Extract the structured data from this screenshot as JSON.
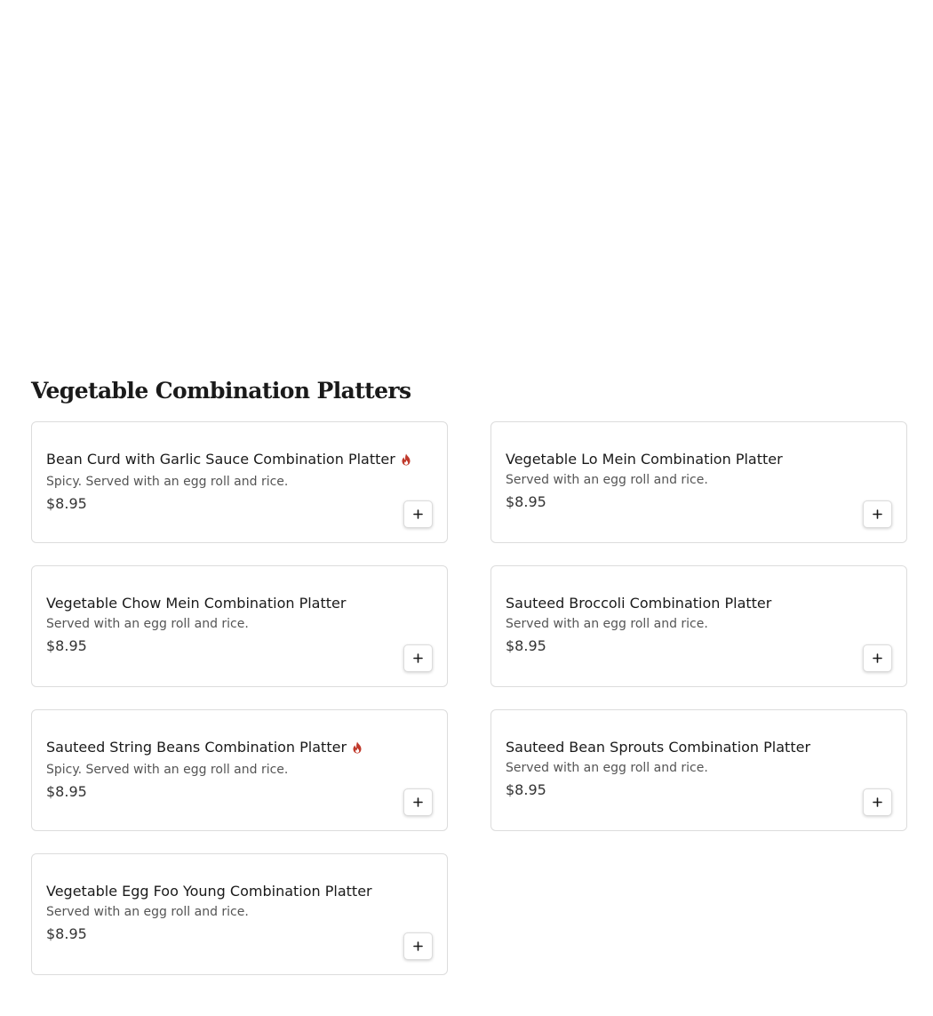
{
  "section": {
    "title": "Vegetable Combination Platters"
  },
  "colors": {
    "spicy_icon": "#c0392b",
    "card_border": "#dcdcdc",
    "text_primary": "#1a1a1a",
    "text_secondary": "#555555"
  },
  "items": [
    {
      "name": "Bean Curd with Garlic Sauce Combination Platter",
      "spicy": true,
      "icon": "flame-icon",
      "description": "Spicy. Served with an egg roll and rice.",
      "price": "$8.95",
      "add_icon": "plus-icon"
    },
    {
      "name": "Vegetable Lo Mein Combination Platter",
      "spicy": false,
      "description": "Served with an egg roll and rice.",
      "price": "$8.95",
      "add_icon": "plus-icon"
    },
    {
      "name": "Vegetable Chow Mein Combination Platter",
      "spicy": false,
      "description": "Served with an egg roll and rice.",
      "price": "$8.95",
      "add_icon": "plus-icon"
    },
    {
      "name": "Sauteed Broccoli Combination Platter",
      "spicy": false,
      "description": "Served with an egg roll and rice.",
      "price": "$8.95",
      "add_icon": "plus-icon"
    },
    {
      "name": "Sauteed String Beans Combination Platter",
      "spicy": true,
      "icon": "flame-icon",
      "description": "Spicy. Served with an egg roll and rice.",
      "price": "$8.95",
      "add_icon": "plus-icon"
    },
    {
      "name": "Sauteed Bean Sprouts Combination Platter",
      "spicy": false,
      "description": "Served with an egg roll and rice.",
      "price": "$8.95",
      "add_icon": "plus-icon"
    },
    {
      "name": "Vegetable Egg Foo Young Combination Platter",
      "spicy": false,
      "description": "Served with an egg roll and rice.",
      "price": "$8.95",
      "add_icon": "plus-icon"
    }
  ]
}
